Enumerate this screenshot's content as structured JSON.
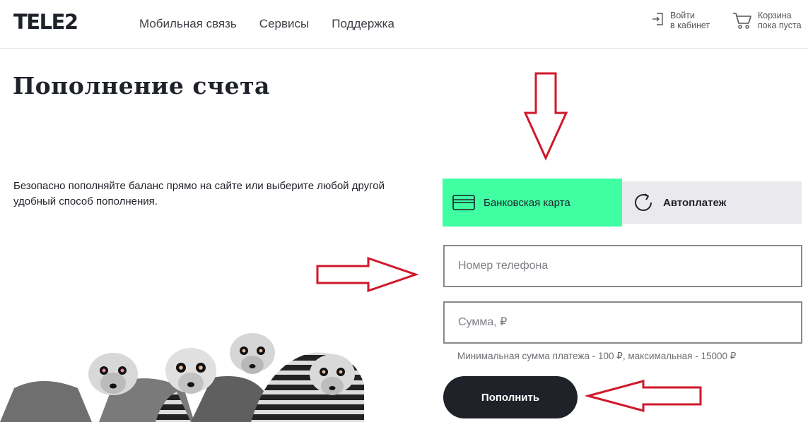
{
  "header": {
    "logo": "TELE2",
    "nav": [
      "Мобильная связь",
      "Сервисы",
      "Поддержка"
    ],
    "login": {
      "line1": "Войти",
      "line2": "в кабинет",
      "icon": "login-icon"
    },
    "cart": {
      "line1": "Корзина",
      "line2": "пока пуста",
      "icon": "cart-icon"
    }
  },
  "page": {
    "title": "Пополнение счета",
    "description": "Безопасно пополняйте баланс прямо на сайте или выберите любой другой удобный способ пополнения."
  },
  "tabs": [
    {
      "label": "Банковская карта",
      "icon": "card-icon",
      "active": true
    },
    {
      "label": "Автоплатеж",
      "icon": "refresh-icon",
      "active": false
    }
  ],
  "form": {
    "phone": {
      "placeholder": "Номер телефона",
      "value": ""
    },
    "sum": {
      "placeholder": "Сумма, ₽",
      "value": ""
    },
    "hint": "Минимальная сумма платежа - 100 ₽, максимальная - 15000 ₽",
    "submit_label": "Пополнить"
  },
  "colors": {
    "accent": "#3fffa2",
    "dark": "#1f2229",
    "tab_inactive": "#e9e9ee",
    "annotation": "#d0182a"
  }
}
